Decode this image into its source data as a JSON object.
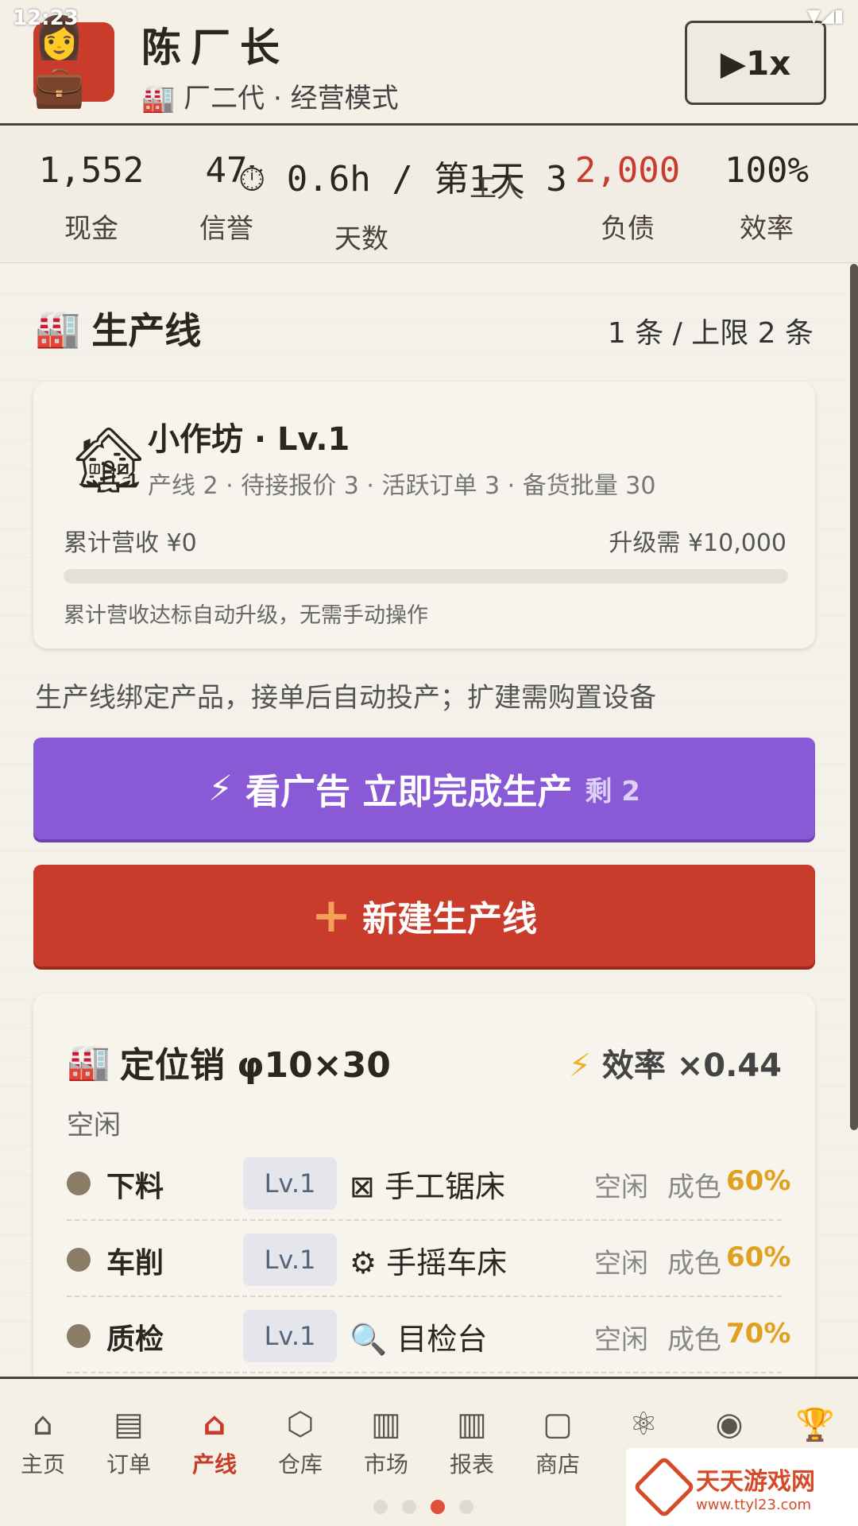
{
  "status_bar": {
    "time": "12:23",
    "icons": "▼◢▮"
  },
  "header": {
    "avatar_icon": "👩💼",
    "name": "陈厂长",
    "subtitle": "🏭 厂二代 · 经营模式",
    "speed_label": "▶1x"
  },
  "stats": [
    {
      "value": "1,552",
      "label": "现金",
      "color": "#2b2620"
    },
    {
      "value": "47",
      "label": "信誉",
      "color": "#2b2620"
    },
    {
      "value": "⏱ 0.6h / 第1天 3",
      "label": "天数",
      "color": "#2b2620"
    },
    {
      "value": "",
      "label": "工人",
      "color": "#2b2620"
    },
    {
      "value": "2,000",
      "label": "负债",
      "color": "#c93b2a"
    },
    {
      "value": "100%",
      "label": "效率",
      "color": "#2b2620"
    }
  ],
  "section": {
    "icon": "🏭",
    "title": "生产线",
    "count": "1 条 / 上限 2 条"
  },
  "workshop": {
    "icon": "🏚",
    "title": "小作坊 · Lv.1",
    "meta": "产线 2 · 待接报价 3 · 活跃订单 3 · 备货批量 30",
    "revenue": "累计营收 ¥0",
    "upgrade": "升级需 ¥10,000",
    "progress": 0,
    "note": "累计营收达标自动升级，无需手动操作"
  },
  "hint": "生产线绑定产品，接单后自动投产；扩建需购置设备",
  "ad_button": {
    "icon": "⚡",
    "label": "看广告 立即完成生产",
    "remain": "剩 2"
  },
  "new_button": {
    "icon": "+",
    "label": "新建生产线"
  },
  "line": {
    "icon": "🏭",
    "title": "定位销 φ10×30",
    "eff_icon": "⚡",
    "efficiency": "效率 ×0.44",
    "state": "空闲",
    "processes": [
      {
        "name": "下料",
        "level": "Lv.1",
        "equip_icon": "⊠",
        "equip": "手工锯床",
        "state": "空闲",
        "quality_label": "成色",
        "quality": "60%"
      },
      {
        "name": "车削",
        "level": "Lv.1",
        "equip_icon": "⚙",
        "equip": "手摇车床",
        "state": "空闲",
        "quality_label": "成色",
        "quality": "60%"
      },
      {
        "name": "质检",
        "level": "Lv.1",
        "equip_icon": "🔍",
        "equip": "目检台",
        "state": "空闲",
        "quality_label": "成色",
        "quality": "70%"
      }
    ]
  },
  "nav": [
    {
      "icon": "⌂",
      "label": "主页",
      "active": false
    },
    {
      "icon": "▤",
      "label": "订单",
      "active": false
    },
    {
      "icon": "⌂",
      "label": "产线",
      "active": true
    },
    {
      "icon": "⬡",
      "label": "仓库",
      "active": false
    },
    {
      "icon": "▥",
      "label": "市场",
      "active": false
    },
    {
      "icon": "▥",
      "label": "报表",
      "active": false
    },
    {
      "icon": "▢",
      "label": "商店",
      "active": false
    },
    {
      "icon": "⚛",
      "label": "",
      "active": false
    },
    {
      "icon": "◉",
      "label": "",
      "active": false
    },
    {
      "icon": "🏆",
      "label": "",
      "active": false
    }
  ],
  "watermark": {
    "title": "天天游戏网",
    "url": "www.ttyl23.com"
  }
}
